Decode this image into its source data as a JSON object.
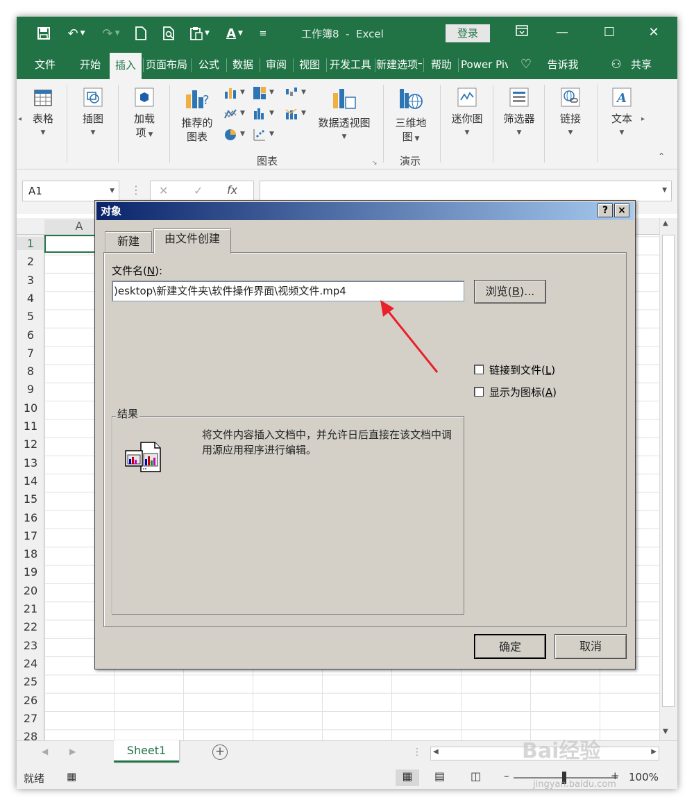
{
  "title_bar": {
    "title": "工作簿8  -  Excel",
    "login_label": "登录",
    "icons": [
      "save-icon",
      "undo-icon",
      "redo-icon",
      "new-icon",
      "print-preview-icon",
      "paste-icon",
      "font-color-icon",
      "customize-icon"
    ],
    "font_color_letter": "A"
  },
  "tabs": [
    "文件",
    "开始",
    "插入",
    "页面布局",
    "公式",
    "数据",
    "审阅",
    "视图",
    "开发工具",
    "新建选项卡",
    "帮助",
    "Power Pivot"
  ],
  "active_tab": "插入",
  "tell_me": "告诉我",
  "share": "共享",
  "ribbon": {
    "tables": "表格",
    "illustrations": "插图",
    "addins_line1": "加载",
    "addins_line2": "项",
    "recommended_line1": "推荐的",
    "recommended_line2": "图表",
    "pivotchart": "数据透视图",
    "charts_group": "图表",
    "map3d_line1": "三维地",
    "map3d_line2": "图",
    "tours_group": "演示",
    "sparklines": "迷你图",
    "filters": "筛选器",
    "links": "链接",
    "text": "文本"
  },
  "formula_bar": {
    "namebox": "A1",
    "fx": "fx"
  },
  "grid": {
    "column_a": "A",
    "rows": [
      "1",
      "2",
      "3",
      "4",
      "5",
      "6",
      "7",
      "8",
      "9",
      "10",
      "11",
      "12",
      "13",
      "14",
      "15",
      "16",
      "17",
      "18",
      "19",
      "20",
      "21",
      "22",
      "23",
      "24",
      "25",
      "26",
      "27",
      "28"
    ]
  },
  "sheet_tab": "Sheet1",
  "status": {
    "ready": "就绪",
    "zoom": "100%"
  },
  "dialog": {
    "title": "对象",
    "help": "?",
    "close": "×",
    "tab_new": "新建",
    "tab_from_file": "由文件创建",
    "file_label_pre": "文件名(",
    "file_label_key": "N",
    "file_label_post": "):",
    "file_value": ")esktop\\新建文件夹\\软件操作界面\\视频文件.mp4",
    "browse_pre": "浏览(",
    "browse_key": "B",
    "browse_post": ")...",
    "link_pre": "链接到文件(",
    "link_key": "L",
    "link_post": ")",
    "icon_pre": "显示为图标(",
    "icon_key": "A",
    "icon_post": ")",
    "result_legend": "结果",
    "result_text": "将文件内容插入文档中，并允许日后直接在该文档中调用源应用程序进行编辑。",
    "ok": "确定",
    "cancel": "取消",
    "link_checked": false,
    "icon_checked": false
  },
  "watermark": {
    "brand": "Bai经验",
    "url": "jingyan.baidu.com"
  },
  "colors": {
    "excel_green": "#217346",
    "dialog_face": "#d4d0c8",
    "arrow_red": "#e8212a"
  }
}
